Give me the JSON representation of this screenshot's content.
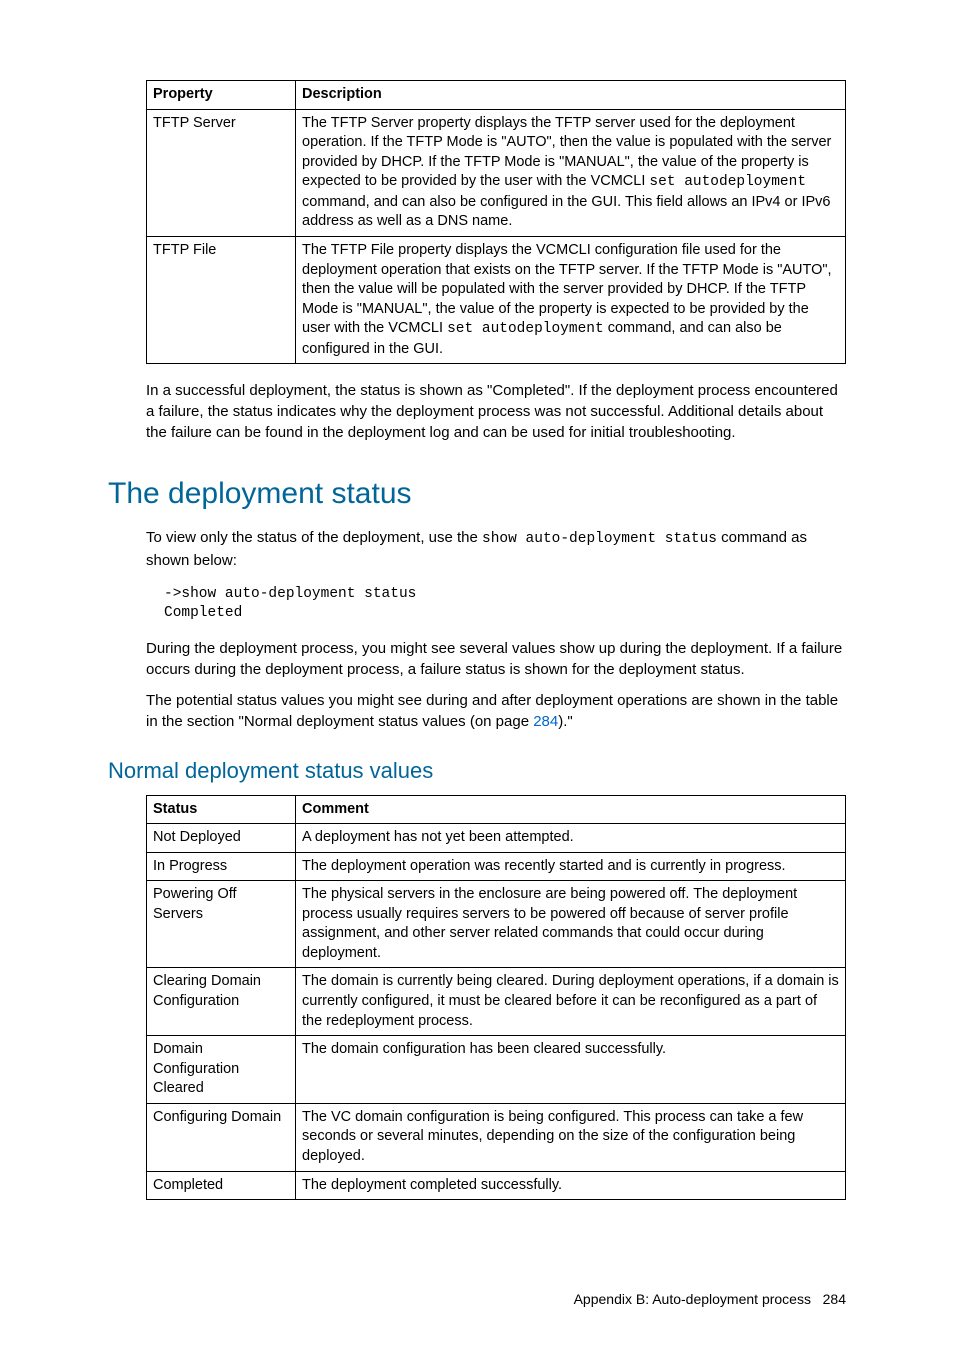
{
  "table1": {
    "headers": [
      "Property",
      "Description"
    ],
    "rows": [
      {
        "property": "TFTP Server",
        "desc_parts": [
          "The TFTP Server property displays the TFTP server used for the deployment operation. If the TFTP Mode is \"AUTO\", then the value is populated with the server provided by DHCP.  If the TFTP Mode is \"MANUAL\", the value of the property is expected to be provided by the user with the VCMCLI ",
          "set autodeployment",
          " command, and can also be configured in the GUI. This field allows an IPv4 or IPv6 address as well as a DNS name."
        ]
      },
      {
        "property": "TFTP File",
        "desc_parts": [
          "The TFTP File property displays the VCMCLI configuration file used for the deployment operation that exists on the TFTP server. If the TFTP Mode is \"AUTO\", then the value will be populated with the server provided by DHCP. If the TFTP Mode is \"MANUAL\", the value of the property is expected to be provided by the user with the VCMCLI ",
          "set autodeployment",
          " command, and can also be configured in the GUI."
        ]
      }
    ]
  },
  "para_after_table1": "In a successful deployment, the status is shown as \"Completed\". If the deployment process encountered a failure, the status indicates why the deployment process was not successful. Additional details about the failure can be found in the deployment log and can be used for initial troubleshooting.",
  "h1": "The deployment status",
  "para_intro_parts": [
    "To view only the status of the deployment, use the ",
    "show auto-deployment status",
    " command as shown below:"
  ],
  "codeblock": "->show auto-deployment status\nCompleted",
  "para_mid": "During the deployment process, you might see several values show up during the deployment. If a failure occurs during the deployment process, a failure status is shown for the deployment status.",
  "para_ref_parts": [
    "The potential status values you might see during and after deployment operations are shown in the table in the section \"Normal deployment status values (on page ",
    "284",
    ").\""
  ],
  "h2": "Normal deployment status values",
  "table2": {
    "headers": [
      "Status",
      "Comment"
    ],
    "rows": [
      {
        "status": "Not Deployed",
        "comment": "A deployment has not yet been attempted."
      },
      {
        "status": "In Progress",
        "comment": "The deployment operation was recently started and is currently in progress."
      },
      {
        "status": "Powering Off Servers",
        "comment": "The physical servers in the enclosure are being powered off. The deployment process usually requires servers to be powered off because of server profile assignment, and other server related commands that could occur during deployment."
      },
      {
        "status": "Clearing Domain Configuration",
        "comment": "The domain is currently being cleared.  During deployment operations, if a domain is currently configured, it must be cleared before it can be reconfigured as a part of the redeployment process."
      },
      {
        "status": "Domain Configuration Cleared",
        "comment": "The domain configuration has been cleared successfully."
      },
      {
        "status": "Configuring Domain",
        "comment": "The VC domain configuration is being configured. This process can take a few seconds or several minutes, depending on the size of the configuration being deployed."
      },
      {
        "status": "Completed",
        "comment": "The deployment completed successfully."
      }
    ]
  },
  "footer": {
    "section": "Appendix B: Auto-deployment process",
    "page": "284"
  }
}
